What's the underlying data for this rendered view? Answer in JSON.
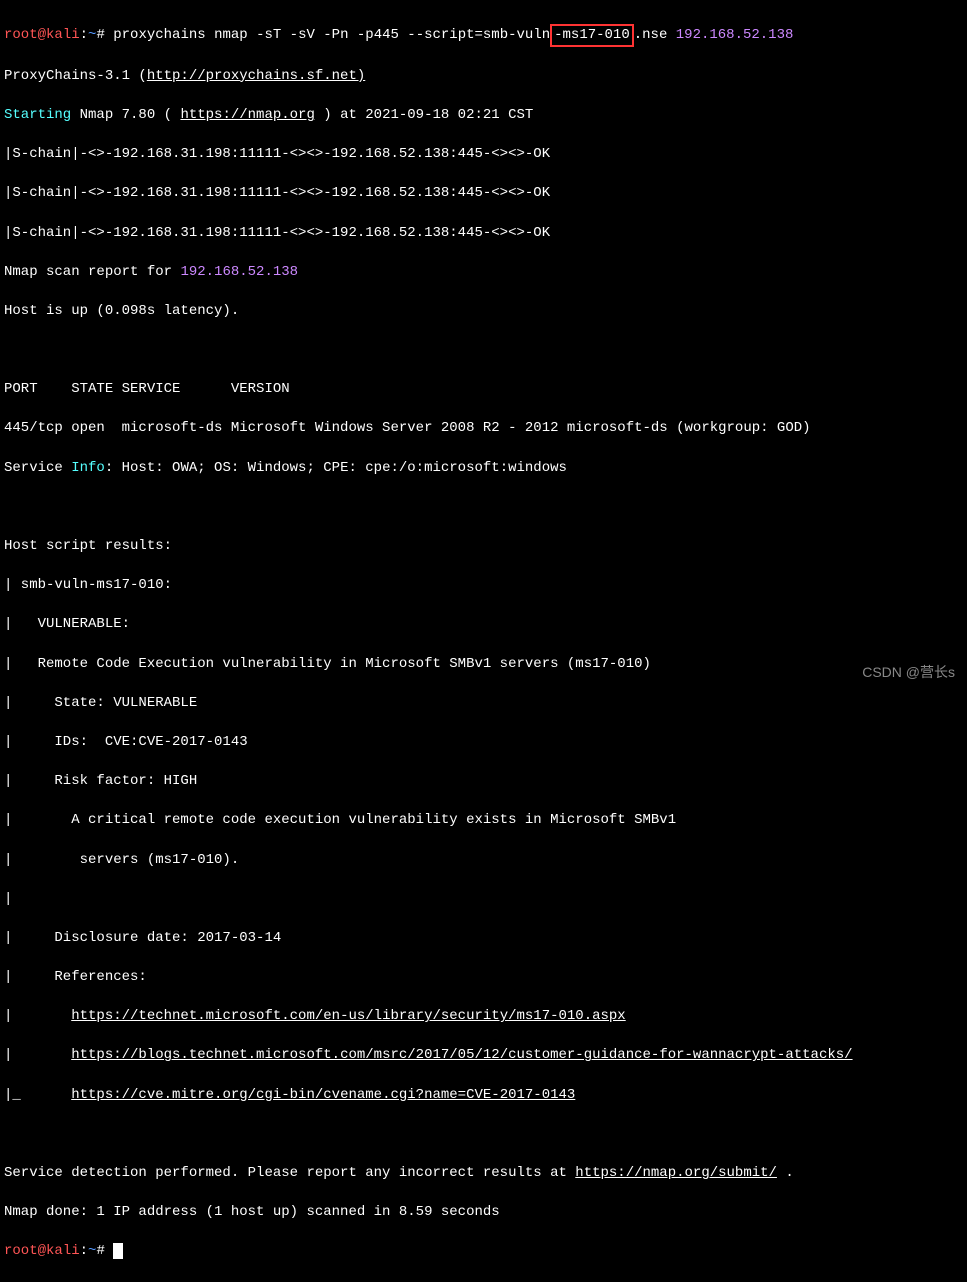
{
  "prompt1": {
    "user": "root",
    "host": "kali",
    "path": "~",
    "symbol": "#",
    "cmd_part1": "proxychains nmap -sT -sV -Pn -p445 --script=smb-vuln",
    "cmd_highlight": "-ms17-010",
    "cmd_part2": ".nse ",
    "cmd_ip": "192.168.52.138"
  },
  "proxychains": {
    "version": "ProxyChains-3.1 (",
    "link": "http://proxychains.sf.net)"
  },
  "nmap_start": {
    "starting": "Starting",
    "text1": " Nmap 7.80 ( ",
    "link": "https://nmap.org",
    "text2": " ) at 2021-09-18 02:21 CST"
  },
  "chains": [
    "|S-chain|-<>-192.168.31.198:11111-<><>-192.168.52.138:445-<><>-OK",
    "|S-chain|-<>-192.168.31.198:11111-<><>-192.168.52.138:445-<><>-OK",
    "|S-chain|-<>-192.168.31.198:11111-<><>-192.168.52.138:445-<><>-OK"
  ],
  "scan_report": {
    "prefix": "Nmap scan report for ",
    "ip": "192.168.52.138"
  },
  "host_up": "Host is up (0.098s latency).",
  "port_header": "PORT    STATE SERVICE      VERSION",
  "port_line": "445/tcp open  microsoft-ds Microsoft Windows Server 2008 R2 - 2012 microsoft-ds (workgroup: GOD)",
  "service_info": {
    "prefix": "Service ",
    "info": "Info",
    "text": ": Host: OWA; OS: Windows; CPE: cpe:/o:microsoft:windows"
  },
  "host_script": "Host script results:",
  "vuln": {
    "l1": "| smb-vuln-ms17-010:",
    "l2": "|   VULNERABLE:",
    "l3": "|   Remote Code Execution vulnerability in Microsoft SMBv1 servers (ms17-010)",
    "l4": "|     State: VULNERABLE",
    "l5": "|     IDs:  CVE:CVE-2017-0143",
    "l6": "|     Risk factor: HIGH",
    "l7": "|       A critical remote code execution vulnerability exists in Microsoft SMBv1",
    "l8": "|        servers (ms17-010).",
    "l9": "|",
    "l10": "|     Disclosure date: 2017-03-14",
    "l11": "|     References:",
    "l12_prefix": "|       ",
    "l12_link": "https://technet.microsoft.com/en-us/library/security/ms17-010.aspx",
    "l13_prefix": "|       ",
    "l13_link": "https://blogs.technet.microsoft.com/msrc/2017/05/12/customer-guidance-for-wannacrypt-attacks/",
    "l14_prefix": "|_      ",
    "l14_link": "https://cve.mitre.org/cgi-bin/cvename.cgi?name=CVE-2017-0143"
  },
  "footer": {
    "detection": "Service detection performed. Please report any incorrect results at ",
    "detection_link": "https://nmap.org/submit/",
    "detection_suffix": " .",
    "done": "Nmap done: 1 IP address (1 host up) scanned in 8.59 seconds"
  },
  "prompt2": {
    "user": "root",
    "host": "kali",
    "path": "~",
    "symbol": "#"
  },
  "watermark": "CSDN @营长s"
}
